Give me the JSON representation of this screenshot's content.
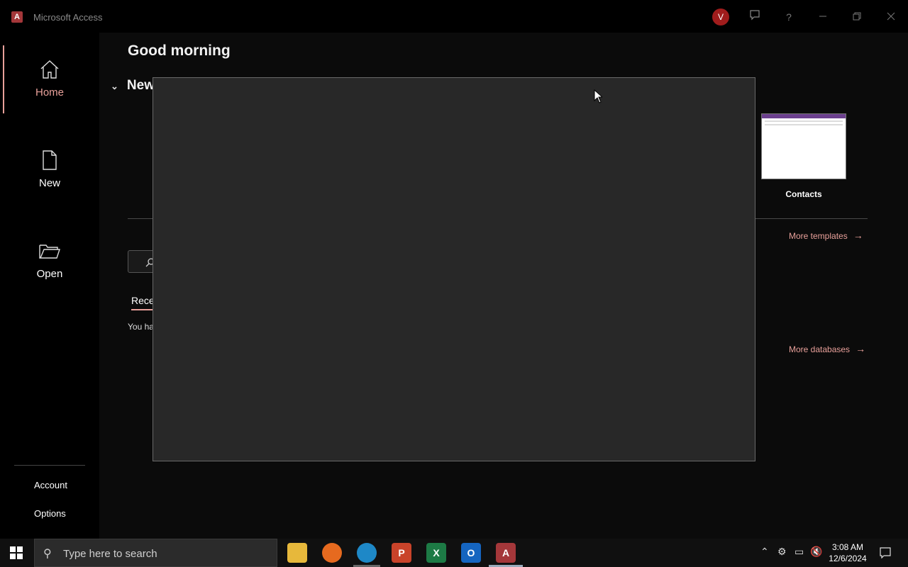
{
  "app": {
    "title": "Microsoft Access",
    "logo_letter": "A",
    "avatar_initial": "V"
  },
  "nav": {
    "items": [
      {
        "label": "Home",
        "icon": "home-icon",
        "active": true
      },
      {
        "label": "New",
        "icon": "new-document-icon",
        "active": false
      },
      {
        "label": "Open",
        "icon": "open-folder-icon",
        "active": false
      }
    ],
    "footer": [
      "Account",
      "Options"
    ]
  },
  "main": {
    "greeting": "Good morning",
    "new_section": "New",
    "templates": [
      {
        "label": "Contacts"
      }
    ],
    "more_templates": "More templates",
    "search_partial": "",
    "recent_tab_partial": "Rece",
    "empty_partial": "You ha",
    "more_databases": "More databases"
  },
  "taskbar": {
    "search_placeholder": "Type here to search",
    "apps": [
      "file-explorer",
      "firefox",
      "edge",
      "powerpoint",
      "excel",
      "outlook",
      "access"
    ],
    "time": "3:08 AM",
    "date": "12/6/2024"
  },
  "colors": {
    "accent": "#e8a09a",
    "access_red": "#a4373a",
    "dialog_bg": "#282828"
  }
}
